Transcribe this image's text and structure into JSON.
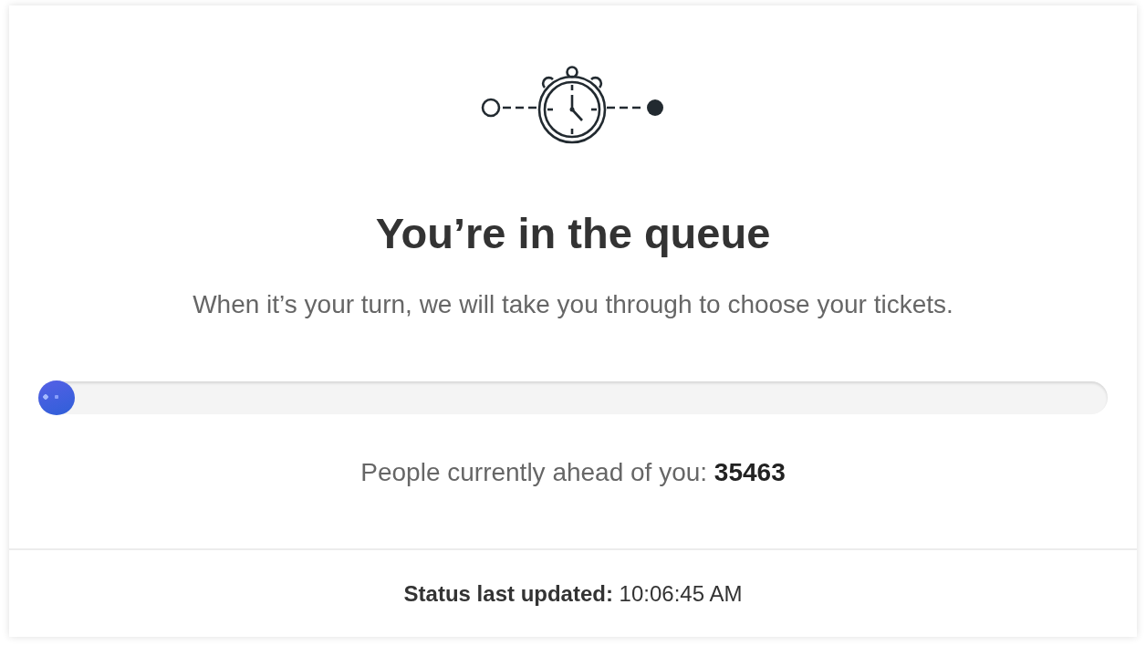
{
  "title": "You’re in the queue",
  "subtitle": "When it’s your turn, we will take you through to choose your tickets.",
  "progress": {
    "level": 0
  },
  "queue_status": "People currently ahead of you: **35463**",
  "footer": {
    "status": "**Status last updated:** 10:06:45 AM"
  }
}
